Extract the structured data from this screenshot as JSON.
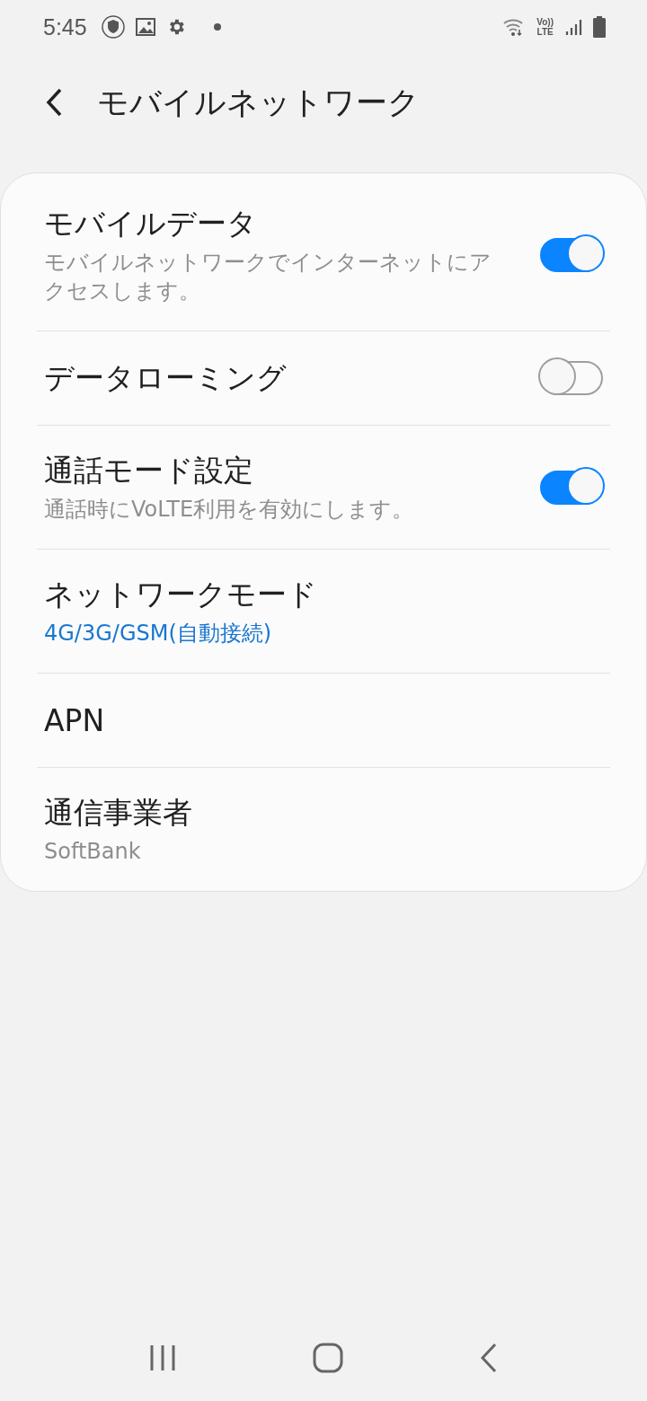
{
  "status_bar": {
    "time": "5:45",
    "network_label_top": "Vo))",
    "network_label_bottom": "LTE"
  },
  "header": {
    "title": "モバイルネットワーク"
  },
  "settings": [
    {
      "kind": "toggle",
      "title": "モバイルデータ",
      "subtitle": "モバイルネットワークでインターネットにアクセスします。",
      "on": true
    },
    {
      "kind": "toggle",
      "title": "データローミング",
      "on": false
    },
    {
      "kind": "toggle",
      "title": "通話モード設定",
      "subtitle": "通話時にVoLTE利用を有効にします。",
      "on": true
    },
    {
      "kind": "link",
      "title": "ネットワークモード",
      "subtitle": "4G/3G/GSM(自動接続)",
      "accent": true
    },
    {
      "kind": "link",
      "title": "APN"
    },
    {
      "kind": "link",
      "title": "通信事業者",
      "subtitle": "SoftBank",
      "accent": false
    }
  ]
}
